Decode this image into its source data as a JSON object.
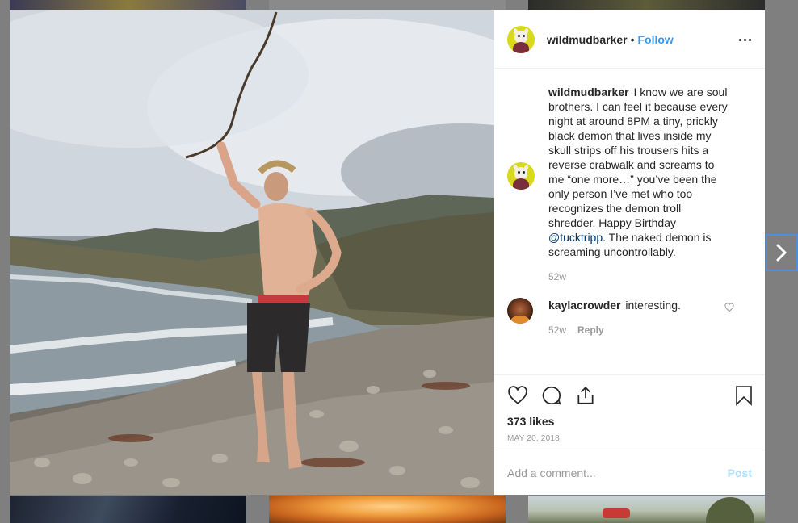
{
  "post": {
    "username": "wildmudbarker",
    "separator": "•",
    "follow_label": "Follow",
    "caption": {
      "username": "wildmudbarker",
      "text_before_mention": "I know we are soul brothers. I can feel it because every night at around 8PM a tiny, prickly black demon that lives inside my skull strips off his trousers hits a reverse crabwalk and screams to me “one more…” you’ve been the only person I’ve met who too recognizes the demon troll shredder. Happy Birthday ",
      "mention": "@tucktripp",
      "text_after_mention": ". The naked demon is screaming uncontrollably.",
      "age": "52w"
    },
    "comments": [
      {
        "username": "kaylacrowder",
        "text": "interesting.",
        "age": "52w",
        "reply_label": "Reply"
      }
    ],
    "likes": "373 likes",
    "date": "MAY 20, 2018",
    "add_comment": {
      "placeholder": "Add a comment...",
      "post_label": "Post"
    }
  },
  "icons": {
    "more": "more-options-icon",
    "heart": "heart-icon",
    "comment": "comment-icon",
    "share": "share-icon",
    "bookmark": "bookmark-icon",
    "next": "chevron-right-icon"
  },
  "colors": {
    "link_blue": "#3897f0",
    "mention_blue": "#003569",
    "post_disabled": "#b2dffc",
    "overlay": "#7f7f7f"
  }
}
